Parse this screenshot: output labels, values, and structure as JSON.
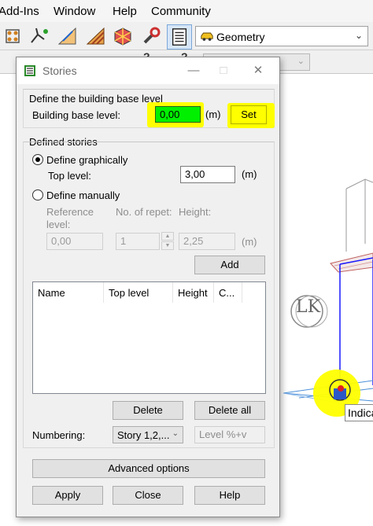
{
  "app": {
    "menu": [
      "Add-Ins",
      "Window",
      "Help",
      "Community"
    ],
    "geometry_select": "Geometry"
  },
  "dialog": {
    "title": "Stories",
    "base_section": "Define the building base level",
    "base_label": "Building base level:",
    "base_value": "0,00",
    "base_unit": "(m)",
    "set_label": "Set",
    "defined_section": "Defined stories",
    "define_graphically": "Define graphically",
    "top_level_label": "Top level:",
    "top_level_value": "3,00",
    "top_level_unit": "(m)",
    "define_manually": "Define manually",
    "ref_level_label1": "Reference",
    "ref_level_label2": "level:",
    "repet_label": "No. of repet:",
    "height_label": "Height:",
    "ref_value": "0,00",
    "repet_value": "1",
    "height_value": "2,25",
    "height_unit": "(m)",
    "add_label": "Add",
    "columns": [
      "Name",
      "Top level",
      "Height",
      "C..."
    ],
    "delete_label": "Delete",
    "delete_all_label": "Delete all",
    "numbering_label": "Numbering:",
    "numbering_value": "Story 1,2,...",
    "numbering_format": "Level %+v",
    "advanced_label": "Advanced options",
    "apply_label": "Apply",
    "close_label": "Close",
    "help_label": "Help"
  },
  "viewport": {
    "badge_text": "Indica"
  },
  "colors": {
    "highlight": "#ffff00",
    "base_field": "#00f000",
    "structure_blue": "#1a1aff"
  }
}
